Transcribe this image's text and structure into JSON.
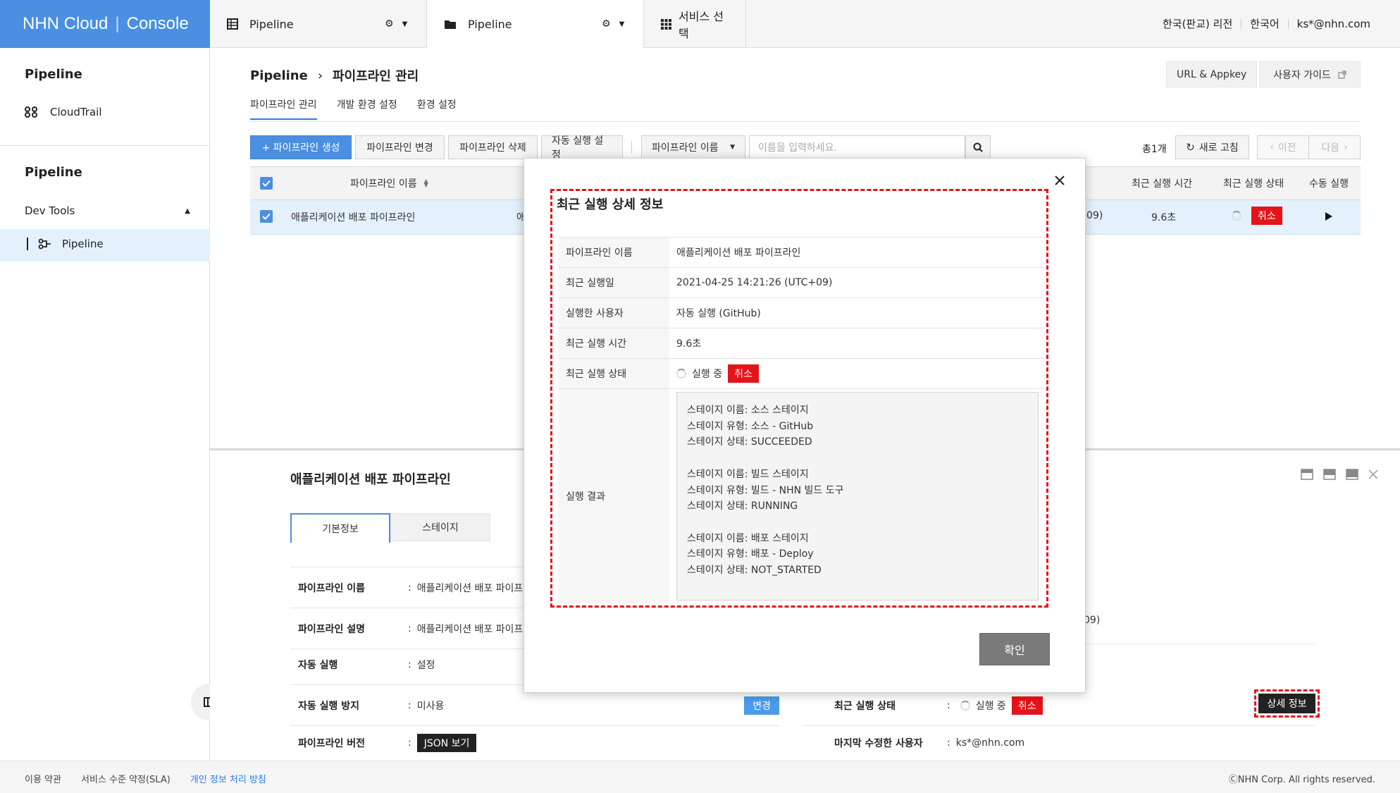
{
  "header": {
    "logo": {
      "brand": "NHN Cloud",
      "product": "Console"
    },
    "tabs": [
      {
        "label": "Pipeline"
      },
      {
        "label": "Pipeline"
      },
      {
        "label": "서비스 선택"
      }
    ],
    "region": "한국(판교) 리전",
    "language": "한국어",
    "user": "ks*@nhn.com"
  },
  "sidebar": {
    "section1_title": "Pipeline",
    "cloudtrail": "CloudTrail",
    "section2_title": "Pipeline",
    "group": "Dev Tools",
    "active_item": "Pipeline"
  },
  "main": {
    "breadcrumb_root": "Pipeline",
    "breadcrumb_current": "파이프라인 관리",
    "url_appkey": "URL & Appkey",
    "user_guide": "사용자 가이드",
    "subtabs": [
      "파이프라인 관리",
      "개발 환경 설정",
      "환경 설정"
    ],
    "toolbar": {
      "create": "+ 파이프라인 생성",
      "edit": "파이프라인 변경",
      "delete": "파이프라인 삭제",
      "auto_run": "자동 실행 설정",
      "filter": "파이프라인 이름",
      "search_placeholder": "이름을 입력하세요.",
      "total": "총1개",
      "refresh": "새로 고침",
      "prev": "이전",
      "next": "다음"
    },
    "table": {
      "headers": {
        "name": "파이프라인 이름",
        "last_time": "최근 실행 시간",
        "last_status": "최근 실행 상태",
        "manual_run": "수동 실행"
      },
      "row": {
        "name": "애플리케이션 배포 파이프라인",
        "desc_partial": "애",
        "date_partial": "-09)",
        "time": "9.6초",
        "cancel": "취소"
      }
    }
  },
  "detail_panel": {
    "title": "애플리케이션 배포 파이프라인",
    "tabs": [
      "기본정보",
      "스테이지"
    ],
    "rows_left": [
      {
        "label": "파이프라인 이름",
        "value": "애플리케이션 배포 파이프"
      },
      {
        "label": "파이프라인 설명",
        "value": "애플리케이션 배포 파이프"
      },
      {
        "label": "자동 실행",
        "value": "설정"
      },
      {
        "label": "자동 실행 방지",
        "value": "미사용",
        "button": "변경"
      },
      {
        "label": "파이프라인 버전",
        "badge": "JSON 보기"
      }
    ],
    "right_partial": "09)",
    "right_rows": [
      {
        "label": "최근 실행 상태",
        "value": "실행 중",
        "cancel": "취소",
        "button": "상세 정보"
      },
      {
        "label": "마지막 수정한 사용자",
        "value": "ks*@nhn.com"
      }
    ]
  },
  "modal": {
    "title": "최근 실행 상세 정보",
    "rows": [
      {
        "key": "파이프라인 이름",
        "value": "애플리케이션 배포 파이프라인"
      },
      {
        "key": "최근 실행일",
        "value": "2021-04-25 14:21:26 (UTC+09)"
      },
      {
        "key": "실행한 사용자",
        "value": "자동 실행 (GitHub)"
      },
      {
        "key": "최근 실행 시간",
        "value": "9.6초"
      },
      {
        "key": "최근 실행 상태",
        "value": "실행 중",
        "cancel": "취소"
      }
    ],
    "result_label": "실행 결과",
    "result_lines": [
      "스테이지 이름: 소스 스테이지",
      "스테이지 유형: 소스 - GitHub",
      "스테이지 상태: SUCCEEDED",
      "",
      "스테이지 이름: 빌드 스테이지",
      "스테이지 유형: 빌드 - NHN 빌드 도구",
      "스테이지 상태: RUNNING",
      "",
      "스테이지 이름: 배포 스테이지",
      "스테이지 유형: 배포 - Deploy",
      "스테이지 상태: NOT_STARTED"
    ],
    "confirm": "확인"
  },
  "footer": {
    "terms": "이용 약관",
    "sla": "서비스 수준 약정(SLA)",
    "privacy": "개인 정보 처리 방침",
    "copyright": "ⒸNHN Corp. All rights reserved."
  },
  "colors": {
    "brand_blue": "#4a8fe2",
    "danger_red": "#e5131a",
    "link_blue": "#2c7ee8"
  }
}
